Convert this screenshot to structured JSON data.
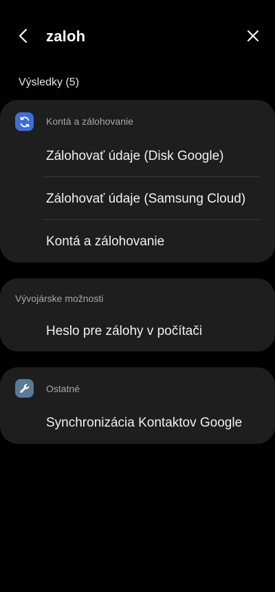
{
  "search": {
    "query": "zaloh",
    "back_icon": "chevron-left-icon",
    "close_icon": "close-icon"
  },
  "results_label": "Výsledky (5)",
  "colors": {
    "background": "#000000",
    "card": "#1e1e1e",
    "accounts_icon": "#3d6fd6",
    "other_icon": "#5a7b96"
  },
  "groups": [
    {
      "category": "Kontá a zálohovanie",
      "icon": "sync-icon",
      "items": [
        {
          "label": "Zálohovať údaje (Disk Google)"
        },
        {
          "label": "Zálohovať údaje (Samsung Cloud)"
        },
        {
          "label": "Kontá a zálohovanie"
        }
      ]
    },
    {
      "category": "Vývojárske možnosti",
      "icon": "",
      "items": [
        {
          "label": "Heslo pre zálohy v počítači"
        }
      ]
    },
    {
      "category": "Ostatné",
      "icon": "wrench-icon",
      "items": [
        {
          "label": "Synchronizácia Kontaktov Google"
        }
      ]
    }
  ]
}
